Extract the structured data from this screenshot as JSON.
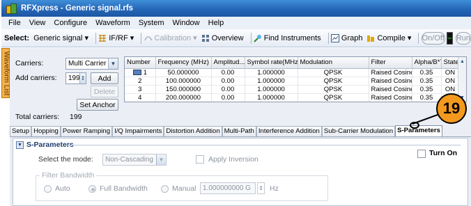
{
  "window": {
    "title": "RFXpress - Generic signal.rfs"
  },
  "menu": [
    "File",
    "View",
    "Configure",
    "Waveform",
    "System",
    "Window",
    "Help"
  ],
  "toolbar": {
    "select_label": "Select:",
    "select_value": "Generic signal",
    "ifrf": "IF/RF",
    "calibration": "Calibration",
    "overview": "Overview",
    "find_instruments": "Find Instruments",
    "graph": "Graph",
    "compile": "Compile",
    "onoff": "On/Off",
    "run": "Run"
  },
  "side_tab": "Waveform List",
  "carriers": {
    "label": "Carriers:",
    "mode": "Multi Carrier",
    "add_label": "Add carriers:",
    "add_value": "199",
    "add_button": "Add",
    "delete_button": "Delete",
    "set_anchor_button": "Set Anchor",
    "total_label": "Total carriers:",
    "total_value": "199"
  },
  "table": {
    "columns": [
      "Number",
      "Frequency (MHz)",
      "Amplitud...",
      "Symbol rate(MHz)",
      "Modulation",
      "Filter",
      "Alpha/B*T",
      "State"
    ],
    "rows": [
      [
        "1",
        "50.000000",
        "0.00",
        "1.000000",
        "QPSK",
        "Raised Cosine",
        "0.35",
        "ON"
      ],
      [
        "2",
        "100.000000",
        "0.00",
        "1.000000",
        "QPSK",
        "Raised Cosine",
        "0.35",
        "ON"
      ],
      [
        "3",
        "150.000000",
        "0.00",
        "1.000000",
        "QPSK",
        "Raised Cosine",
        "0.35",
        "ON"
      ],
      [
        "4",
        "200.000000",
        "0.00",
        "1.000000",
        "QPSK",
        "Raised Cosine",
        "0.35",
        "ON"
      ]
    ]
  },
  "tabs": [
    "Setup",
    "Hopping",
    "Power Ramping",
    "I/Q Impairments",
    "Distortion Addition",
    "Multi-Path",
    "Interference Addition",
    "Sub-Carrier Modulation",
    "S-Parameters"
  ],
  "active_tab": "S-Parameters",
  "sparams": {
    "header": "S-Parameters",
    "turn_on": "Turn On",
    "mode_label": "Select the mode:",
    "mode_value": "Non-Cascading",
    "apply_inversion": "Apply Inversion",
    "filter_bw_label": "Filter Bandwidth",
    "auto": "Auto",
    "full_bw": "Full Bandwidth",
    "manual": "Manual",
    "manual_value": "1.000000000 G",
    "unit": "Hz"
  },
  "callout": "19",
  "colors": {
    "title_bar": "#2466b8",
    "callout": "#f39a1e",
    "side_tab": "#f6b14a"
  }
}
